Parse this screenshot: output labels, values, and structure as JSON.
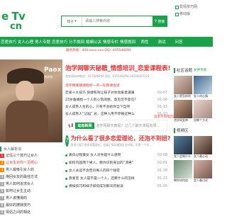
{
  "header": {
    "logo_main": "e Tv",
    "logo_sub": "cn",
    "search": {
      "category": "知子",
      "placeholder": "请输入搜索内容",
      "button": "搜索"
    },
    "top_right": {
      "line1": "爱情技巧网",
      "line2": "移动版"
    }
  },
  "nav": [
    "恋爱技巧",
    "女人心理",
    "男人专题",
    "恋爱技巧",
    "分手挽回",
    "婚姻公关",
    "情感专栏",
    "情感挽回",
    "两性",
    "测试",
    "问答"
  ],
  "notice": {
    "left": "服务热线：400-xxxx-xxx  QQ：615548294",
    "right": "追求不到暗恋的女生？点击这里"
  },
  "slider": {
    "title": "Paox",
    "subtitle": "泡学网"
  },
  "left_list": {
    "header": "女人解析法",
    "rows": [
      {
        "num": "1",
        "color": "red",
        "text": "记住三个技巧让女人",
        "red": false
      },
      {
        "num": "2",
        "color": "orange",
        "text": "让女生对你一见倾心",
        "red": true
      },
      {
        "num": "3",
        "color": "orange",
        "text": "男人最吸引女人的",
        "red": false
      },
      {
        "num": "4",
        "color": "gray",
        "text": "挽回女友的最佳方法",
        "red": false
      },
      {
        "num": "5",
        "color": "gray",
        "text": "男人如何追求女人",
        "red": false
      },
      {
        "num": "6",
        "color": "gray",
        "text": "如何让女生主动",
        "red": false
      },
      {
        "num": "7",
        "color": "gray",
        "text": "男人该懂得的",
        "red": false
      },
      {
        "num": "8",
        "color": "gray",
        "text": "最好的撩妹技巧",
        "red": false
      },
      {
        "num": "9",
        "color": "gray",
        "text": "情侣之间的相处",
        "red": false
      }
    ]
  },
  "center": {
    "headline": "泡学网聊天秘籍_情感培训_恋爱课程表!",
    "byline": "泡学网咨询微信：615548294  QQ：615548294  18106005121",
    "news": [
      {
        "title": "泡学网哪期课程好一点一轮教课合适",
        "date": "",
        "first": true
      },
      {
        "title": "恋爱十大技巧 快捷有效让妹子对你动爱意满满",
        "date": "02-07",
        "first": false
      },
      {
        "title": "23岁备婚愁一个人的心慌闹想，意见可不意见?",
        "date": "01-16",
        "first": false
      },
      {
        "title": "女人成熟人生的心，只有不会给你当下自然",
        "date": "01-13",
        "first": false
      },
      {
        "title": "女人成熟人“记蹈” 总，这种人用不停换这种么",
        "date": "01-10",
        "first": false
      }
    ],
    "dynamic": {
      "tag": "动态新闻",
      "text": "泡学网聊天教程？过几个聊天课程效果..."
    },
    "feature": {
      "title": "为什么看了很多恋爱理论，还泡不到妞?",
      "desc": "很多人看了很多恋爱理论，但真正实际遇到女生时候，不是一个字..."
    },
    "list2": [
      {
        "title": "表白过程美女 女人对你是什么感觉",
        "date": "02-08"
      },
      {
        "title": "如何巩固两个男人，教你识别身边的“渣男”",
        "date": "02-01"
      },
      {
        "title": "女人永远不会告诉男人的四个秘密",
        "date": "01-30"
      },
      {
        "title": "我爱您 女人是不是一个人，还要什么的怎样",
        "date": "01-23"
      },
      {
        "title": "撩妹技巧和妹子如何成功聊天的秘诀",
        "date": "01-16"
      }
    ]
  },
  "right": {
    "section1": {
      "title": "社区话题",
      "more": "女神亲授",
      "items": [
        "女人是怎样的",
        "女人的心情",
        "泡学网女神",
        "用哪个方式"
      ]
    },
    "section2": {
      "title": "视频区",
      "items": [
        "女人会做什么",
        "女人最心动",
        "教你如何追",
        "女人最讨厌"
      ]
    }
  }
}
